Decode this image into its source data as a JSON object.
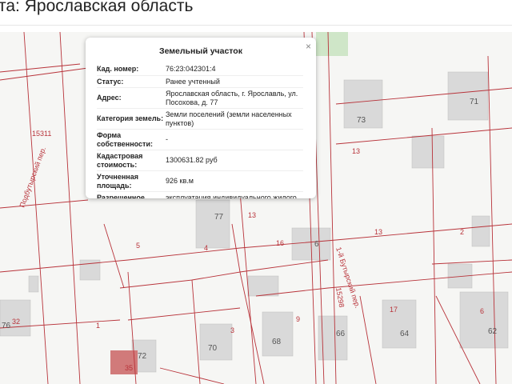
{
  "header": {
    "title": "та: Ярославская область"
  },
  "map": {
    "labels": [
      {
        "text": "15311",
        "kind": "lbl"
      },
      {
        "text": "Подбутырский пер.",
        "kind": "lbl"
      },
      {
        "text": "77",
        "kind": "num"
      },
      {
        "text": "13",
        "kind": "lbl"
      },
      {
        "text": "5",
        "kind": "lbl"
      },
      {
        "text": "4",
        "kind": "lbl"
      },
      {
        "text": "16",
        "kind": "lbl"
      },
      {
        "text": "6",
        "kind": "num"
      },
      {
        "text": "1-й Бутырский пер.",
        "kind": "lbl"
      },
      {
        "text": "15298",
        "kind": "lbl"
      },
      {
        "text": "73",
        "kind": "num"
      },
      {
        "text": "71",
        "kind": "num"
      },
      {
        "text": "13",
        "kind": "lbl"
      },
      {
        "text": "13",
        "kind": "lbl"
      },
      {
        "text": "76",
        "kind": "num"
      },
      {
        "text": "32",
        "kind": "lbl"
      },
      {
        "text": "1",
        "kind": "lbl"
      },
      {
        "text": "72",
        "kind": "num"
      },
      {
        "text": "35",
        "kind": "lbl"
      },
      {
        "text": "70",
        "kind": "num"
      },
      {
        "text": "3",
        "kind": "lbl"
      },
      {
        "text": "68",
        "kind": "num"
      },
      {
        "text": "9",
        "kind": "lbl"
      },
      {
        "text": "66",
        "kind": "num"
      },
      {
        "text": "17",
        "kind": "lbl"
      },
      {
        "text": "64",
        "kind": "num"
      },
      {
        "text": "6",
        "kind": "lbl"
      },
      {
        "text": "62",
        "kind": "num"
      },
      {
        "text": "2",
        "kind": "lbl"
      }
    ]
  },
  "popup": {
    "title": "Земельный участок",
    "close": "×",
    "rows": [
      {
        "k": "Кад. номер:",
        "v": "76:23:042301:4"
      },
      {
        "k": "Статус:",
        "v": "Ранее учтенный"
      },
      {
        "k": "Адрес:",
        "v": "Ярославская область, г. Ярославль, ул. Посохова, д. 77"
      },
      {
        "k": "Категория земель:",
        "v": "Земли поселений (земли населенных пунктов)"
      },
      {
        "k": "Форма собственности:",
        "v": "-"
      },
      {
        "k": "Кадастровая стоимость:",
        "v": "1300631.82 руб"
      },
      {
        "k": "Уточненная площадь:",
        "v": "926 кв.м"
      },
      {
        "k": "Разрешенное",
        "v": "эксплуатация индивидуального жилого"
      }
    ]
  }
}
